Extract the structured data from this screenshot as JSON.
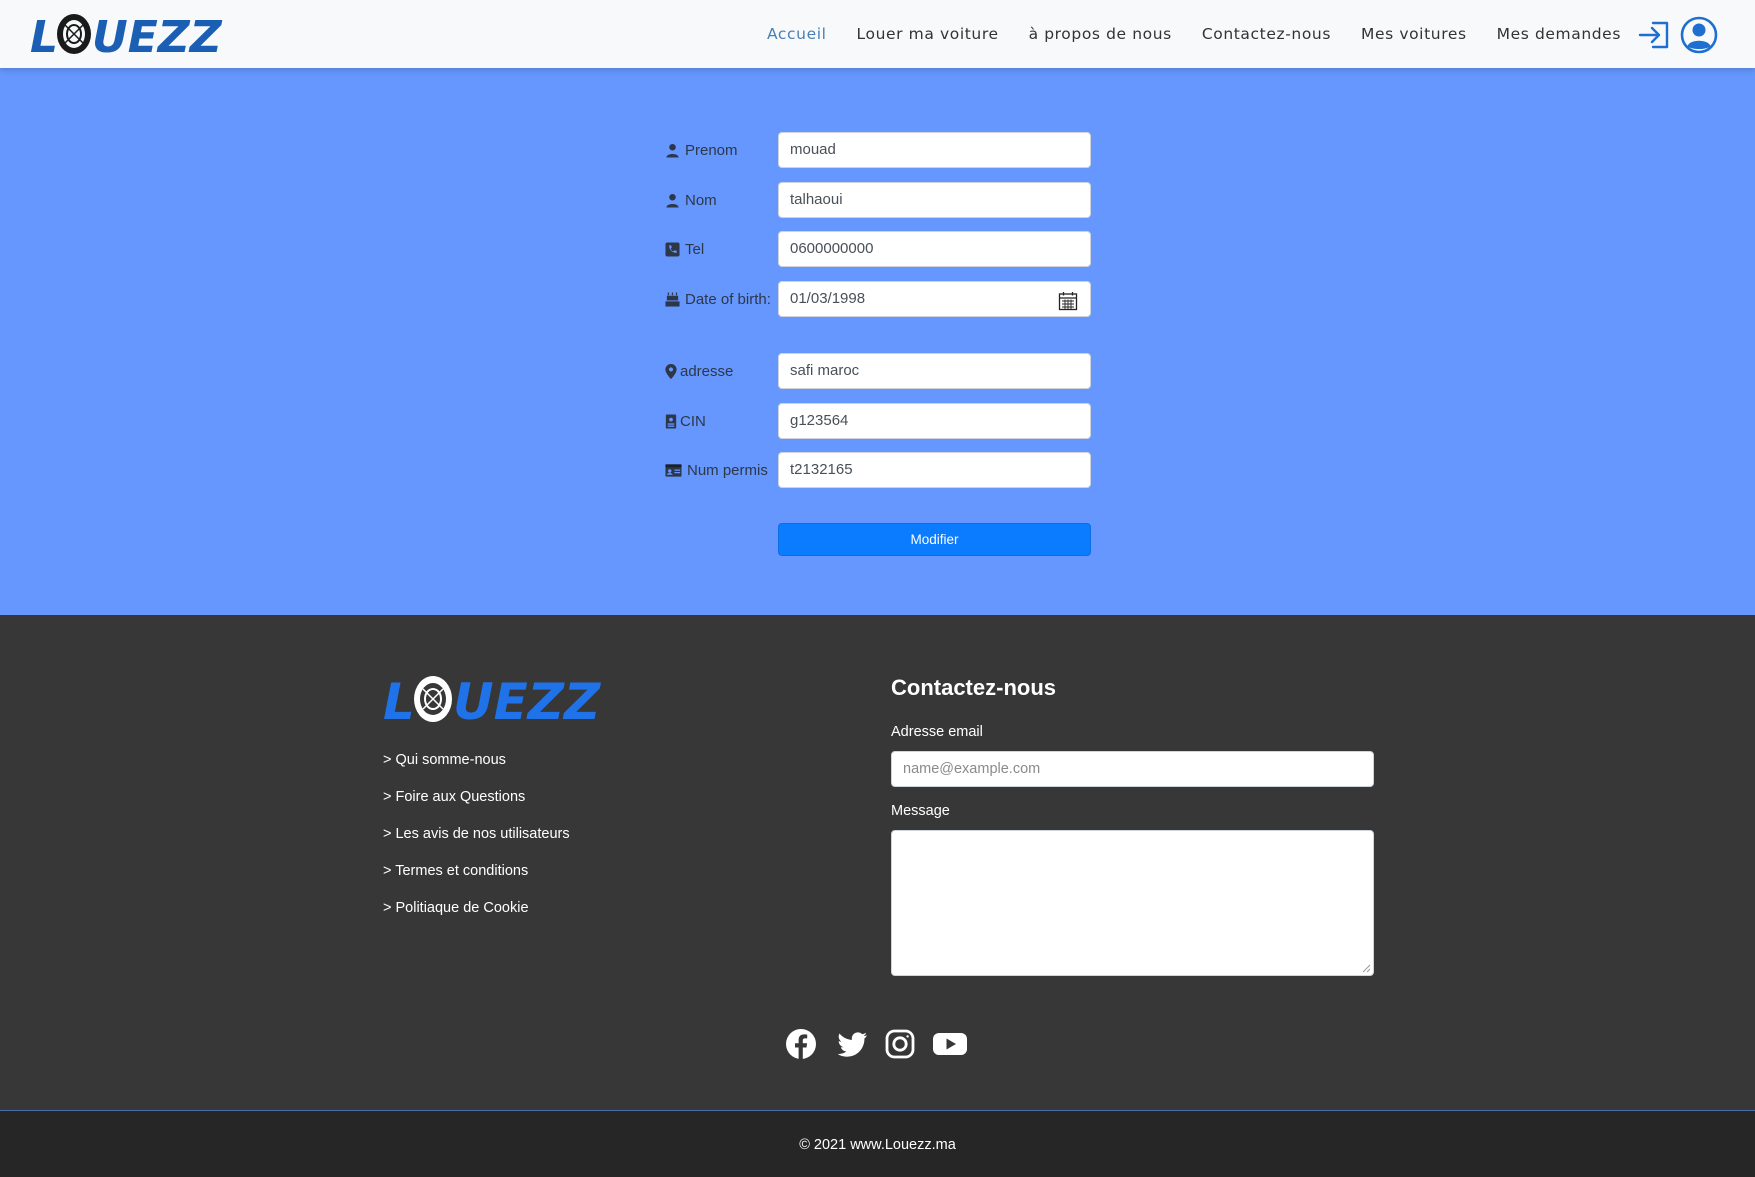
{
  "brand": {
    "logo_text": "LOUEZZ",
    "accent_color": "#1a5fb4",
    "footer_accent_color": "#1f72e8"
  },
  "navbar": {
    "links": [
      {
        "label": "Accueil",
        "active": true
      },
      {
        "label": "Louer ma voiture",
        "active": false
      },
      {
        "label": "à propos de nous",
        "active": false
      },
      {
        "label": "Contactez-nous",
        "active": false
      },
      {
        "label": "Mes voitures",
        "active": false
      },
      {
        "label": "Mes demandes",
        "active": false
      }
    ],
    "icons": [
      "login-icon",
      "user-circle-icon"
    ]
  },
  "profile_form": {
    "background": "#6597fe",
    "fields": [
      {
        "label": "Prenom",
        "icon": "user-icon",
        "value": "mouad"
      },
      {
        "label": "Nom",
        "icon": "user-icon",
        "value": "talhaoui"
      },
      {
        "label": "Tel",
        "icon": "phone-icon",
        "value": "0600000000"
      },
      {
        "label": "Date of birth:",
        "icon": "birthday-cake-icon",
        "value": "01/03/1998",
        "type": "date"
      },
      {
        "label": "adresse",
        "icon": "map-marker-icon",
        "value": "safi maroc"
      },
      {
        "label": "CIN",
        "icon": "id-badge-icon",
        "value": "g123564"
      },
      {
        "label": "Num permis",
        "icon": "id-card-icon",
        "value": "t2132165"
      }
    ],
    "submit_label": "Modifier"
  },
  "footer": {
    "links": [
      "> Qui somme-nous",
      "> Foire aux Questions",
      "> Les avis de nos utilisateurs",
      "> Termes et conditions",
      "> Politiaque de Cookie"
    ],
    "contact": {
      "title": "Contactez-nous",
      "email_label": "Adresse email",
      "email_placeholder": "name@example.com",
      "message_label": "Message"
    },
    "social_icons": [
      "facebook-icon",
      "twitter-icon",
      "instagram-icon",
      "youtube-icon"
    ],
    "copyright": "© 2021 www.Louezz.ma"
  }
}
